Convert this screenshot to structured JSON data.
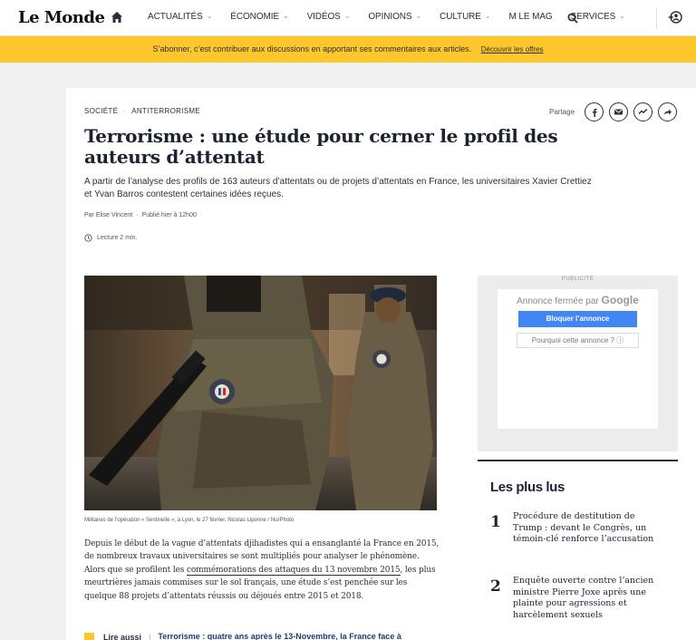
{
  "header": {
    "logo": "Le Monde",
    "nav": [
      "ACTUALITÉS",
      "ÉCONOMIE",
      "VIDÉOS",
      "OPINIONS",
      "CULTURE",
      "M LE MAG",
      "SERVICES"
    ],
    "nav_has_chevron": [
      true,
      true,
      true,
      true,
      true,
      false,
      true
    ]
  },
  "banner": {
    "text": "S’abonner, c’est contribuer aux discussions en apportant ses commentaires aux articles.",
    "link": "Découvrir les offres"
  },
  "article": {
    "breadcrumb": [
      "SOCIÉTÉ",
      "ANTITERRORISME"
    ],
    "share_label": "Partage",
    "share_icons": [
      "facebook-icon",
      "mail-icon",
      "messenger-icon",
      "share-icon"
    ],
    "title": "Terrorisme : une étude pour cerner le profil des auteurs d’attentat",
    "lead": "A partir de l’analyse des profils de 163 auteurs d’attentats ou de projets d’attentats en France, les universitaires Xavier Crettiez et Yvan Barros contestent certaines idées reçues.",
    "author": "Par Elise Vincent",
    "published": "Publié hier à 12h00",
    "reading_time": "Lecture 2 min.",
    "photo_caption": "Militaires de l’opération « Sentinelle », à Lyon, le 27 février. Nicolas Liponne / NurPhoto",
    "body_1": "Depuis le début de la vague d’attentats djihadistes qui a ensanglanté la France en 2015, de nombreux travaux universitaires se sont multipliés pour analyser le phénomène. Alors que se profilent les ",
    "body_link": "commémorations des attaques du 13 novembre 2015",
    "body_2": ", les plus meurtrières jamais commises sur le sol français, une étude s’est penchée sur les quelque 88 projets d’attentats réussis ou déjoués entre 2015 et 2018.",
    "read_also_label": "Lire aussi",
    "read_also_link": "Terrorisme : quatre ans après le 13-Novembre, la France face à"
  },
  "ad": {
    "label": "PUBLICITÉ",
    "closed_text": "Annonce fermée par",
    "closed_brand": "Google",
    "block_button": "Bloquer l’annonce",
    "why_button": "Pourquoi cette annonce ?"
  },
  "most_read": {
    "title": "Les plus lus",
    "items": [
      {
        "num": "1",
        "text": "Procédure de destitution de Trump : devant le Congrès, un témoin-clé renforce l’accusation"
      },
      {
        "num": "2",
        "text": "Enquête ouverte contre l’ancien ministre Pierre Joxe après une plainte pour agressions et harcèlement sexuels"
      }
    ]
  },
  "colors": {
    "banner": "#ffc72c",
    "ad_button": "#4285f4",
    "text": "#2a303b",
    "link": "#1a3d6d"
  }
}
